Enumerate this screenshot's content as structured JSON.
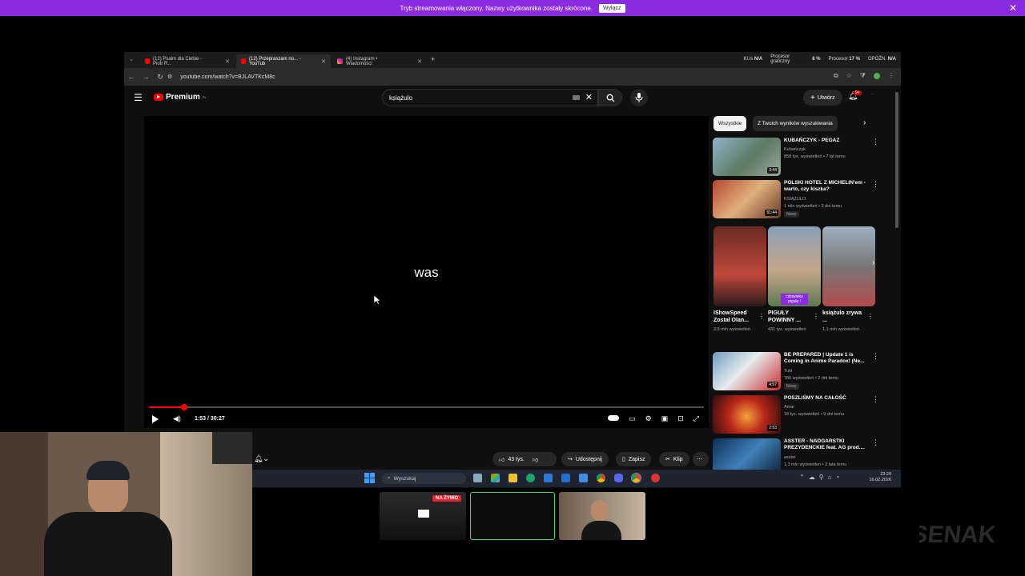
{
  "banner": {
    "text": "Tryb streamowania włączony. Nazwy użytkownika zostały skrócone.",
    "button": "Wyłącz"
  },
  "browser": {
    "tabs": [
      {
        "label": "(12) Psalm dla Ciebie - Piotr R..."
      },
      {
        "label": "(12) Przepraszam no... - YouTub"
      },
      {
        "label": "(4) Instagram • Wiadomości"
      }
    ],
    "sysinfo": {
      "kl": "Kl./s",
      "kl_val": "N/A",
      "gpu": "Procesor graficzny",
      "gpu_val": "8 %",
      "cpu": "Procesor",
      "cpu_val": "17 %",
      "lag": "OPÓŹN.",
      "lag_val": "N/A"
    },
    "url": "youtube.com/watch?v=BJLAVTKcM8c"
  },
  "yt": {
    "logo": "Premium",
    "logo_sup": "PL",
    "search_value": "książulo",
    "create": "Utwórz",
    "bell_badge": "9+",
    "caption": "was",
    "progress": 0.063,
    "time": "1:53 / 30:27",
    "actions": {
      "likes": "43 tys.",
      "share": "Udostępnij",
      "save": "Zapisz",
      "clip": "Klip"
    },
    "chips": [
      "Wszystkie",
      "Z Twoich wyników wyszukiwania"
    ],
    "videos": [
      {
        "title": "KUBAŃCZYK - PEGAZ",
        "channel": "Kubańczyk",
        "meta": "858 tys. wyświetleń • 7 lat temu",
        "dur": "3:44",
        "nowy": ""
      },
      {
        "title": "POLSKI HOTEL Z MICHELIN'em - warto, czy kiszka?",
        "channel": "KSIĄŻULO",
        "meta": "1 mln wyświetleń • 3 dni temu",
        "dur": "51:44",
        "nowy": "Nowy"
      },
      {
        "title": "BE PREPARED | Update 1 is Coming in Anime Paradox! (Ne...",
        "channel": "Tuki",
        "meta": "780 wyświetleń • 2 dni temu",
        "dur": "4:57",
        "nowy": "Nowy"
      },
      {
        "title": "POSZLIŚMY NA CAŁOŚĆ",
        "channel": "Amar",
        "meta": "18 tys. wyświetleń • 9 dni temu",
        "dur": "2:53",
        "nowy": ""
      },
      {
        "title": "ASSTER - NADGARSTKI PREZYDENCKIE feat. AG prod....",
        "channel": "asster",
        "meta": "1,3 mln wyświetleń • 2 lata temu",
        "dur": "",
        "nowy": ""
      }
    ],
    "shorts": [
      {
        "title": "IShowSpeed Został Olan...",
        "meta": "3,8 mln wyświetleń"
      },
      {
        "title": "PIGUŁY POWINNY ...",
        "meta": "431 tys. wyświetleń"
      },
      {
        "title": "książulo zrywa ...",
        "meta": "1,1 mln wyświetleń"
      }
    ],
    "short_overlay": "człowieku pigułę !"
  },
  "taskbar": {
    "search": "Wyszukaj",
    "time": "23:29",
    "date": "16.02.2026"
  },
  "scenes": {
    "live": "NA ŻYWO"
  },
  "watermark": "SENAK"
}
